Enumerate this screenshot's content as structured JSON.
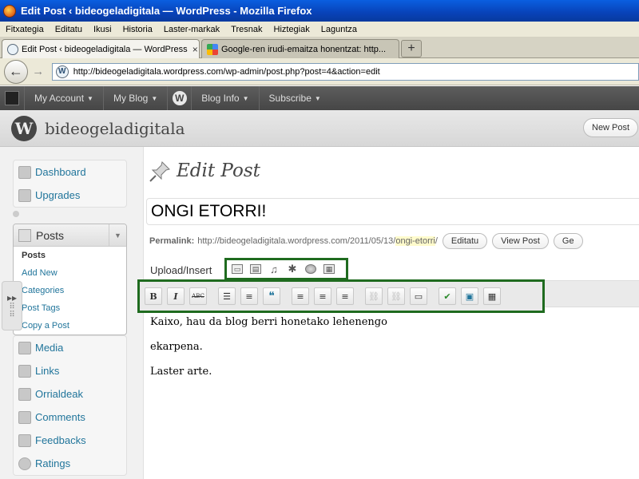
{
  "window": {
    "title": "Edit Post ‹ bideogeladigitala — WordPress - Mozilla Firefox"
  },
  "menubar": [
    "Fitxategia",
    "Editatu",
    "Ikusi",
    "Historia",
    "Laster-markak",
    "Tresnak",
    "Hiztegiak",
    "Laguntza"
  ],
  "tabs": [
    {
      "label": "Edit Post ‹ bideogeladigitala — WordPress",
      "close": "×"
    },
    {
      "label": "Google-ren irudi-emaitza honentzat: http..."
    }
  ],
  "newtab_label": "+",
  "nav": {
    "back": "←",
    "forward": "→",
    "url": "http://bideogeladigitala.wordpress.com/wp-admin/post.php?post=4&action=edit"
  },
  "adminbar": {
    "items": [
      "My Account",
      "My Blog",
      "Blog Info",
      "Subscribe"
    ],
    "wp_letter": "W"
  },
  "site": {
    "logo_letter": "W",
    "name": "bideogeladigitala",
    "new_post": "New Post"
  },
  "sidebar": {
    "top_items": [
      {
        "label": "Dashboard",
        "icon": "dashboard-icon"
      },
      {
        "label": "Upgrades",
        "icon": "upgrades-icon"
      }
    ],
    "posts": {
      "label": "Posts",
      "toggle": "▼",
      "sub_items": [
        "Posts",
        "Add New",
        "Categories",
        "Post Tags",
        "Copy a Post"
      ]
    },
    "bottom_items": [
      {
        "label": "Media",
        "icon": "media-icon"
      },
      {
        "label": "Links",
        "icon": "links-icon"
      },
      {
        "label": "Orrialdeak",
        "icon": "pages-icon"
      },
      {
        "label": "Comments",
        "icon": "comments-icon"
      },
      {
        "label": "Feedbacks",
        "icon": "feedbacks-icon"
      },
      {
        "label": "Ratings",
        "icon": "ratings-icon"
      }
    ],
    "collapse_arrows": "▸▸"
  },
  "main": {
    "page_title": "Edit Post",
    "post_title": "ONGI ETORRI!",
    "permalink": {
      "label": "Permalink:",
      "base": "http://bideogeladigitala.wordpress.com/2011/05/13/",
      "slug": "ongi-etorri",
      "trail": "/",
      "edit_button": "Editatu",
      "view_button": "View Post",
      "extra_button": "Ge"
    },
    "upload_label": "Upload/Insert",
    "upload_icons": [
      "▭",
      "▤",
      "♫",
      "✱",
      "●",
      "▦"
    ],
    "toolbar": [
      {
        "name": "bold-button",
        "glyph": "B"
      },
      {
        "name": "italic-button",
        "glyph": "I"
      },
      {
        "name": "strikethrough-button",
        "glyph": "ABC"
      },
      {
        "name": "bullet-list-button",
        "glyph": "☰"
      },
      {
        "name": "numbered-list-button",
        "glyph": "≡"
      },
      {
        "name": "blockquote-button",
        "glyph": "❝"
      },
      {
        "name": "align-left-button",
        "glyph": "≡"
      },
      {
        "name": "align-center-button",
        "glyph": "≡"
      },
      {
        "name": "align-right-button",
        "glyph": "≡"
      },
      {
        "name": "link-button",
        "glyph": "⛓"
      },
      {
        "name": "unlink-button",
        "glyph": "⛓"
      },
      {
        "name": "more-tag-button",
        "glyph": "▭"
      },
      {
        "name": "spellcheck-button",
        "glyph": "✔"
      },
      {
        "name": "fullscreen-button",
        "glyph": "▣"
      },
      {
        "name": "kitchen-sink-button",
        "glyph": "▦"
      }
    ],
    "content": [
      "Kaixo, hau da blog berri honetako lehenengo",
      "ekarpena.",
      "Laster arte."
    ]
  }
}
